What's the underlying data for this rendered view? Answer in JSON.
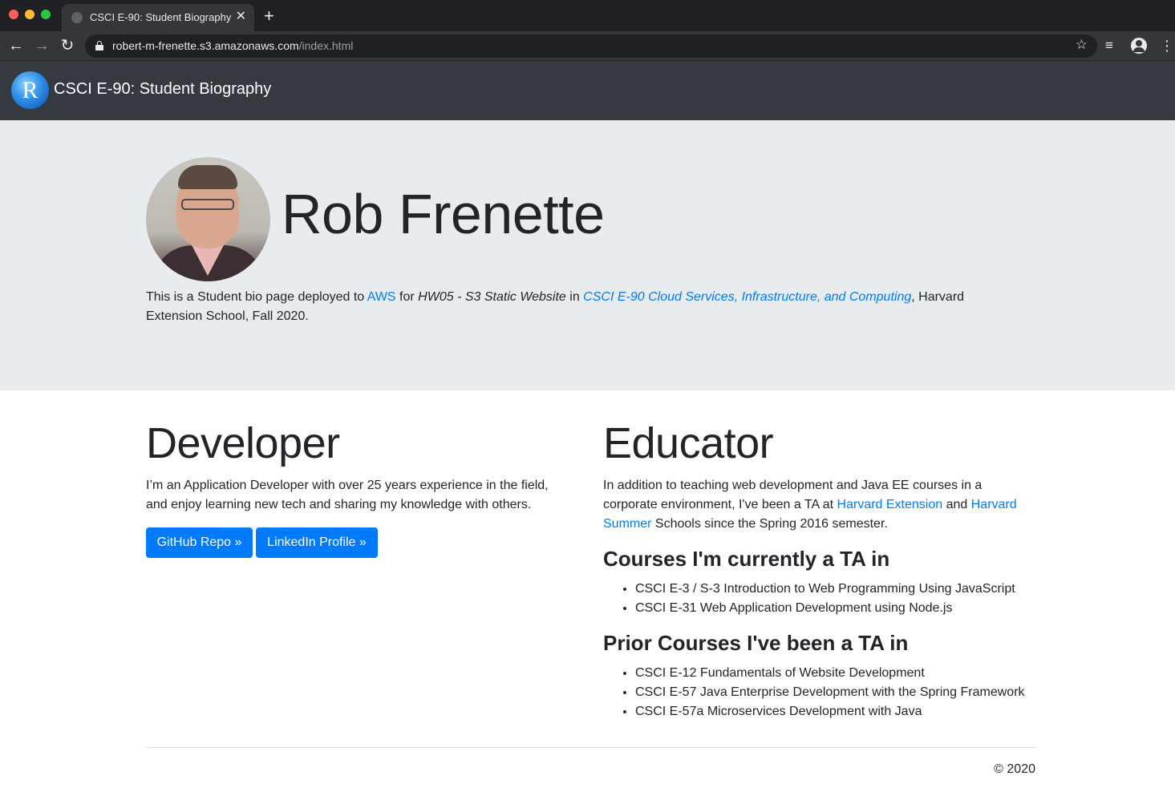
{
  "browser": {
    "tab_title": "CSCI E-90: Student Biography",
    "tab_close": "✕",
    "new_tab": "+",
    "url_host": "robert-m-frenette.s3.amazonaws.com",
    "url_path": "/index.html"
  },
  "navbar": {
    "logo_letter": "R",
    "brand": "CSCI E-90: Student Biography"
  },
  "hero": {
    "name": "Rob Frenette",
    "intro_prefix": "This is a Student bio page deployed to ",
    "aws_link": "AWS",
    "intro_for": " for ",
    "assignment": "HW05 - S3 Static Website",
    "intro_in": " in ",
    "course_link": "CSCI E-90 Cloud Services, Infrastructure, and Computing",
    "intro_suffix": ", Harvard Extension School, Fall 2020."
  },
  "developer": {
    "title": "Developer",
    "text_line1": "I’m an Application Developer with over 25 years experience in the field,",
    "text_line2": "and enjoy learning new tech and sharing my knowledge with others.",
    "github_button": "GitHub Repo »",
    "linkedin_button": "LinkedIn Profile »"
  },
  "educator": {
    "title": "Educator",
    "text_line1": "In addition to teaching web development and Java EE courses in a",
    "text_line2_prefix": "corporate environment, I've been a TA at ",
    "harvard_extension_link": "Harvard Extension",
    "text_and": " and ",
    "harvard_summer_link_a": "Harvard",
    "harvard_summer_link_b": "Summer",
    "text_line3_suffix": " Schools since the Spring 2016 semester.",
    "current_title": "Courses I'm currently a TA in",
    "current_courses": [
      "CSCI E-3 / S-3 Introduction to Web Programming Using JavaScript",
      "CSCI E-31 Web Application Development using Node.js"
    ],
    "prior_title": "Prior Courses I've been a TA in",
    "prior_courses": [
      "CSCI E-12 Fundamentals of Website Development",
      "CSCI E-57 Java Enterprise Development with the Spring Framework",
      "CSCI E-57a Microservices Development with Java"
    ]
  },
  "footer": {
    "copyright": "© 2020"
  }
}
